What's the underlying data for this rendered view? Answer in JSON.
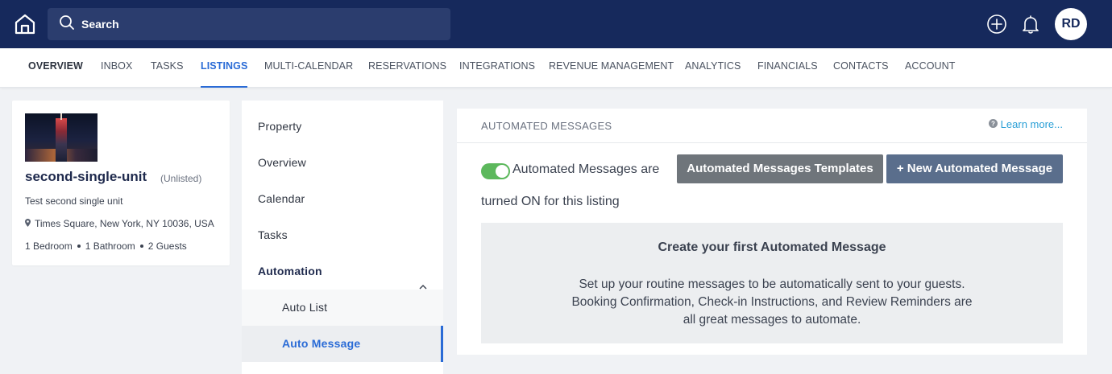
{
  "topbar": {
    "search_placeholder": "Search",
    "avatar_initials": "RD",
    "icons": [
      "home-icon",
      "search-icon",
      "plus-circle-icon",
      "bell-icon"
    ]
  },
  "nav": {
    "items": [
      "OVERVIEW",
      "INBOX",
      "TASKS",
      "LISTINGS",
      "MULTI-CALENDAR",
      "RESERVATIONS",
      "INTEGRATIONS",
      "REVENUE MANAGEMENT",
      "ANALYTICS",
      "FINANCIALS",
      "CONTACTS",
      "ACCOUNT"
    ],
    "active": "LISTINGS"
  },
  "listing": {
    "name": "second-single-unit",
    "status": "(Unlisted)",
    "description": "Test second single unit",
    "address": "Times Square, New York, NY 10036, USA",
    "bedrooms": "1 Bedroom",
    "bathrooms": "1 Bathroom",
    "guests": "2 Guests"
  },
  "side_menu": {
    "items": [
      "Property",
      "Overview",
      "Calendar",
      "Tasks"
    ],
    "group": "Automation",
    "sub_items": [
      "Auto List",
      "Auto Message"
    ],
    "active": "Auto Message"
  },
  "panel": {
    "title": "AUTOMATED MESSAGES",
    "learn_more": "Learn more...",
    "toggle_on": true,
    "status_line1": "Automated Messages are",
    "status_line2": "turned ON for this listing",
    "templates_button": "Automated Messages Templates",
    "new_button": "+ New Automated Message",
    "empty_title": "Create your first Automated Message",
    "empty_text": "Set up your routine messages to be automatically sent to your guests. Booking Confirmation, Check-in Instructions, and Review Reminders are all great messages to automate."
  },
  "colors": {
    "topbar": "#16295c",
    "accent": "#2a6bd6",
    "toggle_on": "#5cb85c",
    "templates_button": "#6f757b",
    "new_button": "#5a6e8c",
    "link": "#2a9fd6"
  }
}
